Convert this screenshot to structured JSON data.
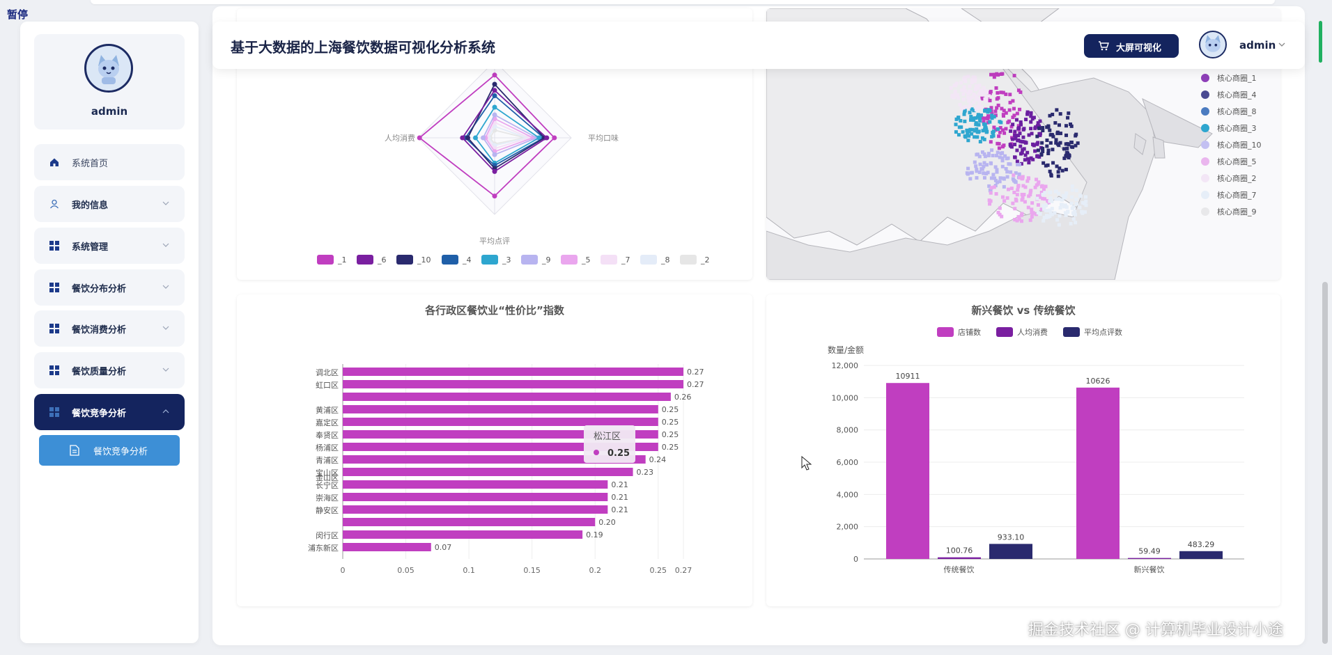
{
  "corner_label": "暂停",
  "sidebar": {
    "username": "admin",
    "items": [
      {
        "label": "系统首页",
        "icon": "home-icon",
        "expand": false,
        "active": false
      },
      {
        "label": "我的信息",
        "icon": "user-icon",
        "expand": true,
        "active": false
      },
      {
        "label": "系统管理",
        "icon": "grid-icon",
        "expand": true,
        "active": false
      },
      {
        "label": "餐饮分布分析",
        "icon": "grid-icon",
        "expand": true,
        "active": false
      },
      {
        "label": "餐饮消费分析",
        "icon": "grid-icon",
        "expand": true,
        "active": false
      },
      {
        "label": "餐饮质量分析",
        "icon": "grid-icon",
        "expand": true,
        "active": false
      },
      {
        "label": "餐饮竞争分析",
        "icon": "grid-icon",
        "expand": true,
        "active": true
      }
    ],
    "submenu": {
      "label": "餐饮竞争分析",
      "icon": "document-icon"
    }
  },
  "header": {
    "title": "基于大数据的上海餐饮数据可视化分析系统",
    "bigscreen_label": "大屏可视化",
    "username": "admin"
  },
  "colors": {
    "navy": "#14245e",
    "magenta": "#c03ec0",
    "purple": "#7a1fa0",
    "deep_navy": "#2a2a6e",
    "submenu_blue": "#3d8fd6"
  },
  "watermark": "掘金技术社区 @ 计算机毕业设计小途",
  "chart_data": [
    {
      "type": "radar",
      "indicators": [
        "人均消费",
        "平均口味",
        "平均点评"
      ],
      "series": [
        {
          "name": "_1",
          "color": "#c03ec0",
          "values": [
            0.82,
            0.78,
            0.76,
            0.98
          ]
        },
        {
          "name": "_6",
          "color": "#7a1fa0",
          "values": [
            0.62,
            0.68,
            0.44,
            0.42
          ]
        },
        {
          "name": "_10",
          "color": "#2a2a6e",
          "values": [
            0.7,
            0.65,
            0.4,
            0.35
          ]
        },
        {
          "name": "_4",
          "color": "#1f5fa8",
          "values": [
            0.55,
            0.64,
            0.36,
            0.38
          ]
        },
        {
          "name": "_3",
          "color": "#2ea6cf",
          "values": [
            0.4,
            0.58,
            0.33,
            0.25
          ]
        },
        {
          "name": "_9",
          "color": "#b8b4f0",
          "values": [
            0.3,
            0.55,
            0.22,
            0.15
          ]
        },
        {
          "name": "_5",
          "color": "#eaa6ee",
          "values": [
            0.25,
            0.5,
            0.18,
            0.12
          ]
        },
        {
          "name": "_7",
          "color": "#f4e0f6",
          "values": [
            0.2,
            0.45,
            0.14,
            0.1
          ]
        },
        {
          "name": "_8",
          "color": "#e4ecf8",
          "values": [
            0.15,
            0.42,
            0.1,
            0.08
          ]
        },
        {
          "name": "_2",
          "color": "#e6e6e6",
          "values": [
            0.1,
            0.4,
            0.08,
            0.06
          ]
        }
      ]
    },
    {
      "type": "scatter",
      "legend": [
        {
          "name": "核心商圈_1",
          "color": "#8e3fb8"
        },
        {
          "name": "核心商圈_4",
          "color": "#4a4a92"
        },
        {
          "name": "核心商圈_8",
          "color": "#4b7bc0"
        },
        {
          "name": "核心商圈_3",
          "color": "#2ea6cf"
        },
        {
          "name": "核心商圈_10",
          "color": "#c3c0f2"
        },
        {
          "name": "核心商圈_5",
          "color": "#eab6ee"
        },
        {
          "name": "核心商圈_2",
          "color": "#f3e6f6"
        },
        {
          "name": "核心商圈_7",
          "color": "#e6eef8"
        },
        {
          "name": "核心商圈_9",
          "color": "#e8e8ea"
        }
      ]
    },
    {
      "type": "bar",
      "orientation": "horizontal",
      "title": "各行政区餐饮业“性价比”指数",
      "values": [
        0.27,
        0.27,
        0.26,
        0.25,
        0.25,
        0.25,
        0.25,
        0.24,
        0.23,
        0.21,
        0.21,
        0.21,
        0.2,
        0.19,
        0.07
      ],
      "value_labels": [
        "0.27",
        "0.27",
        "0.26",
        "0.25",
        "0.25",
        "0.25",
        "0.25",
        "0.24",
        "0.23",
        "0.21",
        "0.21",
        "0.21",
        "0.20",
        "0.19",
        "0.07"
      ],
      "category_labels": [
        {
          "text": "调北区",
          "row": 0
        },
        {
          "text": "虹口区",
          "row": 1
        },
        {
          "text": "黄浦区",
          "row": 3
        },
        {
          "text": "嘉定区",
          "row": 4
        },
        {
          "text": "奉贤区",
          "row": 5
        },
        {
          "text": "杨浦区",
          "row": 6
        },
        {
          "text": "青浦区",
          "row": 7
        },
        {
          "text": "宝山区",
          "row": 8
        },
        {
          "text": "金山区",
          "row": 8.4
        },
        {
          "text": "长宁区",
          "row": 9
        },
        {
          "text": "崇海区",
          "row": 10
        },
        {
          "text": "静安区",
          "row": 11
        },
        {
          "text": "闵行区",
          "row": 13
        },
        {
          "text": "浦东新区",
          "row": 14
        }
      ],
      "xticks": [
        "0",
        "0.05",
        "0.1",
        "0.15",
        "0.2",
        "0.25",
        "0.27"
      ],
      "xlim": [
        0,
        0.27
      ],
      "tooltip": {
        "label": "松江区",
        "value": "0.25"
      },
      "color": "#c03ec0"
    },
    {
      "type": "bar",
      "title": "新兴餐饮 vs 传统餐饮",
      "ylabel": "数量/金额",
      "categories": [
        "传统餐饮",
        "新兴餐饮"
      ],
      "series": [
        {
          "name": "店铺数",
          "color": "#c03ec0",
          "values": [
            10911,
            10626
          ],
          "labels": [
            "10911",
            "10626"
          ]
        },
        {
          "name": "人均消费",
          "color": "#7a1fa0",
          "values": [
            100.76,
            59.49
          ],
          "labels": [
            "100.76",
            "59.49"
          ]
        },
        {
          "name": "平均点评数",
          "color": "#2a2a6e",
          "values": [
            933.1,
            483.29
          ],
          "labels": [
            "933.10",
            "483.29"
          ]
        }
      ],
      "ylim": [
        0,
        12000
      ],
      "yticks": [
        "0",
        "2,000",
        "4,000",
        "6,000",
        "8,000",
        "10,000",
        "12,000"
      ]
    }
  ]
}
